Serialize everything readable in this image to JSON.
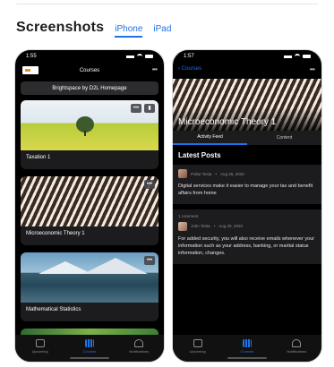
{
  "header": {
    "title": "Screenshots",
    "tabs": [
      {
        "label": "iPhone",
        "active": true
      },
      {
        "label": "iPad",
        "active": false
      }
    ]
  },
  "phone1": {
    "status": {
      "time": "1:55"
    },
    "nav_title": "Courses",
    "homepage_button": "Brightspace by D2L Homepage",
    "courses": [
      {
        "label": "Taxation 1"
      },
      {
        "label": "Microeconomic Theory 1"
      },
      {
        "label": "Mathematical Statistics"
      }
    ],
    "tabbar": [
      {
        "label": "Upcoming"
      },
      {
        "label": "Courses"
      },
      {
        "label": "Notifications"
      }
    ]
  },
  "phone2": {
    "status": {
      "time": "1:57"
    },
    "back_label": "‹ Courses",
    "hero_title": "Microeconomic Theory 1",
    "subtabs": [
      {
        "label": "Activity Feed"
      },
      {
        "label": "Content"
      }
    ],
    "section_title": "Latest Posts",
    "posts": [
      {
        "author": "Pullar Testa",
        "date": "Aug 25, 2020",
        "body": "Digital services make it easier to manage your tax and benefit affairs from home"
      },
      {
        "comment_label": "1 comment",
        "author": "John Testa",
        "date": "Aug 25, 2020",
        "body": "For added security, you will also receive emails whenever your information such as your address, banking, or marital status information, changes."
      }
    ],
    "tabbar": [
      {
        "label": "Upcoming"
      },
      {
        "label": "Courses"
      },
      {
        "label": "Notifications"
      }
    ]
  },
  "colors": {
    "accent": "#1f73e8",
    "phone_bg": "#000000",
    "card_bg": "#1c1c1e"
  },
  "icons": [
    "more-icon",
    "pin-icon",
    "calendar-icon",
    "grid-icon",
    "bell-icon",
    "back-chevron-icon"
  ]
}
